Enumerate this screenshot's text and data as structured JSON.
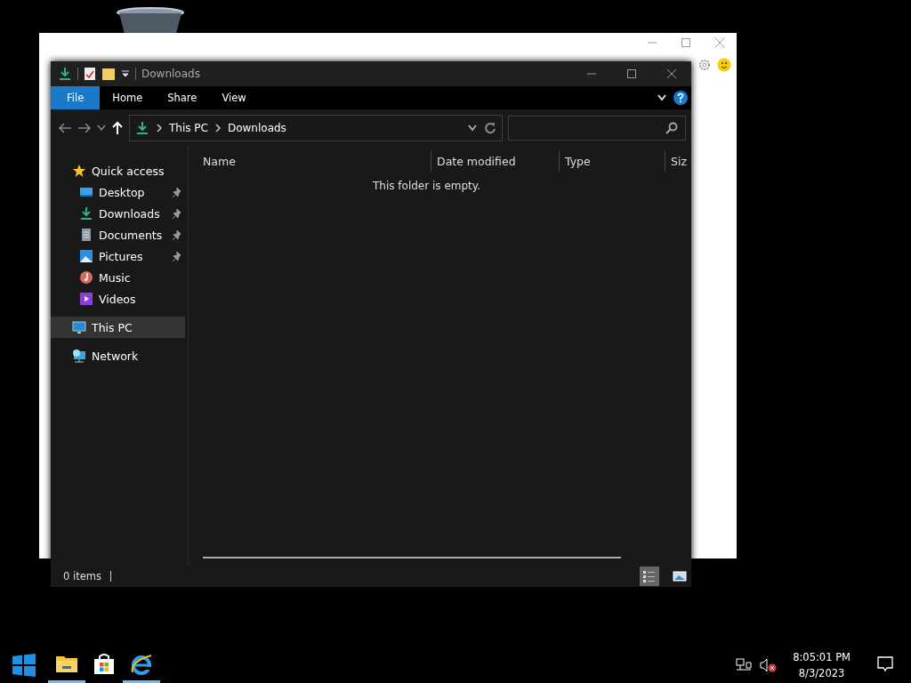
{
  "explorer": {
    "title": "Downloads",
    "ribbon_tabs": [
      {
        "label": "File",
        "selected": true
      },
      {
        "label": "Home",
        "selected": false
      },
      {
        "label": "Share",
        "selected": false
      },
      {
        "label": "View",
        "selected": false
      }
    ],
    "breadcrumb": [
      "This PC",
      "Downloads"
    ],
    "columns": [
      "Name",
      "Date modified",
      "Type",
      "Siz"
    ],
    "empty_message": "This folder is empty.",
    "nav": [
      {
        "label": "Quick access",
        "kind": "star",
        "selected": false,
        "children": [
          {
            "label": "Desktop",
            "kind": "desktop",
            "pinned": true,
            "selected": false
          },
          {
            "label": "Downloads",
            "kind": "download",
            "pinned": true,
            "selected": false
          },
          {
            "label": "Documents",
            "kind": "document",
            "pinned": true,
            "selected": false
          },
          {
            "label": "Pictures",
            "kind": "picture",
            "pinned": true,
            "selected": false
          },
          {
            "label": "Music",
            "kind": "music",
            "pinned": false,
            "selected": false
          },
          {
            "label": "Videos",
            "kind": "video",
            "pinned": false,
            "selected": false
          }
        ]
      },
      {
        "label": "This PC",
        "kind": "pc",
        "selected": true
      },
      {
        "label": "Network",
        "kind": "network",
        "selected": false
      }
    ],
    "status": "0 items",
    "views": [
      {
        "kind": "details",
        "selected": true
      },
      {
        "kind": "large",
        "selected": false
      }
    ]
  },
  "taskbar": {
    "apps": [
      {
        "kind": "folder",
        "running": true
      },
      {
        "kind": "store",
        "running": false
      },
      {
        "kind": "browser",
        "running": true
      }
    ],
    "time": "8:05:01 PM",
    "date": "8/3/2023"
  }
}
